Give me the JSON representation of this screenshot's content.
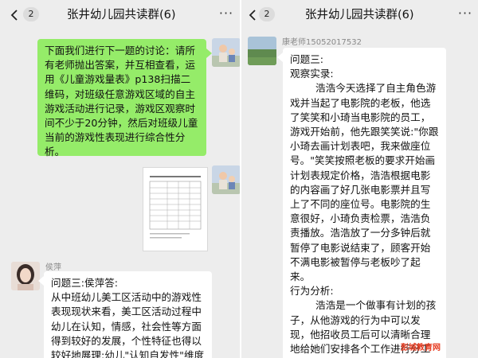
{
  "left": {
    "header": {
      "badge": "2",
      "title": "张井幼儿园共读群(6)",
      "more": "···"
    },
    "msg1": {
      "text": "下面我们进行下一题的讨论：请所有老师抛出答案，并互相查看，运用《儿童游戏量表》p138扫描二维码，对班级任意游戏区域的自主游戏活动进行记录，游戏区观察时间不少于20分钟，然后对班级儿童当前的游戏性表现进行综合性分析。"
    },
    "msg3": {
      "sender": "侯萍",
      "text": "问题三:侯萍答:\n从中班幼儿美工区活动中的游戏性表现现状来看，美工区活动过程中幼儿在认知，情感，社会性等方面得到较好的发展，个性特征也得以较好地展理:幼儿\"认知自发性\"维度中游戏性表现水平"
    }
  },
  "right": {
    "header": {
      "badge": "2",
      "title": "张井幼儿园共读群(6)",
      "more": "···"
    },
    "msg": {
      "sender": "康老师15052017532",
      "text": "问题三:\n观察实录:\n        浩浩今天选择了自主角色游戏并当起了电影院的老板，他选了笑笑和小琦当电影院的员工，游戏开始前，他先跟笑笑说:\"你跟小琦去画计划表吧，我来做座位号。\"笑笑按照老板的要求开始画计划表规定价格，浩浩根据电影的内容画了好几张电影票并且写上了不同的座位号。电影院的生意很好，小琦负责检票，浩浩负责播放。浩浩放了一分多钟后就暂停了电影说结束了，顾客开始不满电影被暂停与老板吵了起来。\n行为分析:\n        浩浩是一个做事有计划的孩子，从他游戏的行为中可以发现，他招收员工后可以清晰合理地给她们安排各个工作进行分工合作。他的游戏经验比较丰富以及语言表达能力也较高，所以在开展新游戏时是比较顺利的。"
    }
  },
  "watermark": "彭城教育网",
  "colors": {
    "bg": "#ededed",
    "green_bubble": "#95ec69",
    "white_bubble": "#ffffff"
  }
}
